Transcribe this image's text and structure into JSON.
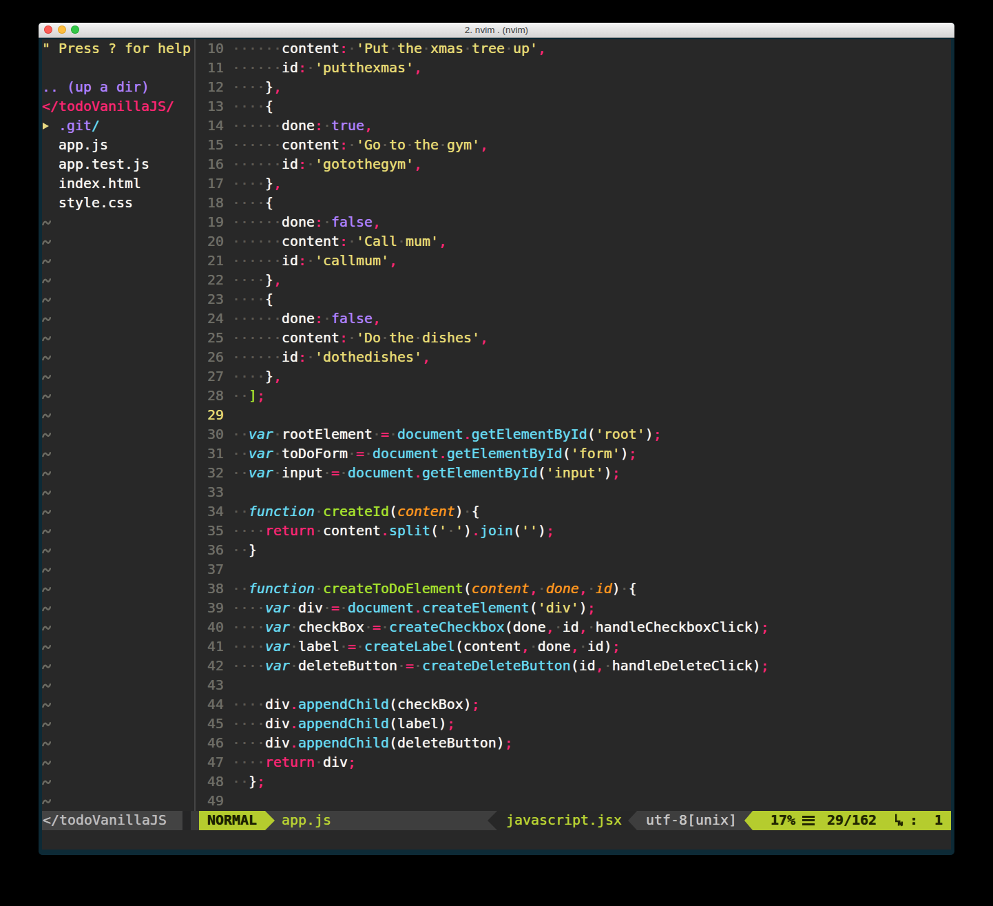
{
  "title_bar": {
    "title": "2. nvim . (nvim)",
    "buttons": [
      "close",
      "minimize",
      "zoom"
    ]
  },
  "colors": {
    "terminal_padding": "#0d2a36",
    "editor_background": "#282828",
    "foreground": "#f8f8f2",
    "pink": "#f92672",
    "yellow": "#e6db74",
    "cyan": "#66d9ef",
    "green": "#a6e22e",
    "orange": "#fd971f",
    "purple": "#ae81ff",
    "airline_green": "#b5cc2e"
  },
  "sidebar": {
    "rows": [
      [
        [
          "y",
          "\" Press ? for help"
        ]
      ],
      [],
      [
        [
          "u",
          ".. (up a dir)"
        ]
      ],
      [
        [
          "p",
          "</todoVanillaJS/"
        ]
      ],
      [
        [
          "arrow",
          ""
        ],
        [
          "w",
          " "
        ],
        [
          "u",
          ".git"
        ],
        [
          "c",
          "/"
        ]
      ],
      [
        [
          "w",
          "  app.js"
        ]
      ],
      [
        [
          "w",
          "  app.test.js"
        ]
      ],
      [
        [
          "w",
          "  index.html"
        ]
      ],
      [
        [
          "w",
          "  style.css"
        ]
      ]
    ],
    "tilde": "~",
    "tilde_count": 31
  },
  "editor": {
    "current_line": 29,
    "rows": [
      {
        "n": "10",
        "t": [
          [
            "w",
            "      content"
          ],
          [
            "p",
            ":"
          ],
          [
            "w",
            " "
          ],
          [
            "y",
            "'Put the xmas tree up'"
          ],
          [
            "p",
            ","
          ]
        ]
      },
      {
        "n": "11",
        "t": [
          [
            "w",
            "      id"
          ],
          [
            "p",
            ":"
          ],
          [
            "w",
            " "
          ],
          [
            "y",
            "'putthexmas'"
          ],
          [
            "p",
            ","
          ]
        ]
      },
      {
        "n": "12",
        "t": [
          [
            "w",
            "    }"
          ],
          [
            "p",
            ","
          ]
        ]
      },
      {
        "n": "13",
        "t": [
          [
            "w",
            "    {"
          ]
        ]
      },
      {
        "n": "14",
        "t": [
          [
            "w",
            "      done"
          ],
          [
            "p",
            ":"
          ],
          [
            "w",
            " "
          ],
          [
            "u",
            "true"
          ],
          [
            "p",
            ","
          ]
        ]
      },
      {
        "n": "15",
        "t": [
          [
            "w",
            "      content"
          ],
          [
            "p",
            ":"
          ],
          [
            "w",
            " "
          ],
          [
            "y",
            "'Go to the gym'"
          ],
          [
            "p",
            ","
          ]
        ]
      },
      {
        "n": "16",
        "t": [
          [
            "w",
            "      id"
          ],
          [
            "p",
            ":"
          ],
          [
            "w",
            " "
          ],
          [
            "y",
            "'gotothegym'"
          ],
          [
            "p",
            ","
          ]
        ]
      },
      {
        "n": "17",
        "t": [
          [
            "w",
            "    }"
          ],
          [
            "p",
            ","
          ]
        ]
      },
      {
        "n": "18",
        "t": [
          [
            "w",
            "    {"
          ]
        ]
      },
      {
        "n": "19",
        "t": [
          [
            "w",
            "      done"
          ],
          [
            "p",
            ":"
          ],
          [
            "w",
            " "
          ],
          [
            "u",
            "false"
          ],
          [
            "p",
            ","
          ]
        ]
      },
      {
        "n": "20",
        "t": [
          [
            "w",
            "      content"
          ],
          [
            "p",
            ":"
          ],
          [
            "w",
            " "
          ],
          [
            "y",
            "'Call mum'"
          ],
          [
            "p",
            ","
          ]
        ]
      },
      {
        "n": "21",
        "t": [
          [
            "w",
            "      id"
          ],
          [
            "p",
            ":"
          ],
          [
            "w",
            " "
          ],
          [
            "y",
            "'callmum'"
          ],
          [
            "p",
            ","
          ]
        ]
      },
      {
        "n": "22",
        "t": [
          [
            "w",
            "    }"
          ],
          [
            "p",
            ","
          ]
        ]
      },
      {
        "n": "23",
        "t": [
          [
            "w",
            "    {"
          ]
        ]
      },
      {
        "n": "24",
        "t": [
          [
            "w",
            "      done"
          ],
          [
            "p",
            ":"
          ],
          [
            "w",
            " "
          ],
          [
            "u",
            "false"
          ],
          [
            "p",
            ","
          ]
        ]
      },
      {
        "n": "25",
        "t": [
          [
            "w",
            "      content"
          ],
          [
            "p",
            ":"
          ],
          [
            "w",
            " "
          ],
          [
            "y",
            "'Do the dishes'"
          ],
          [
            "p",
            ","
          ]
        ]
      },
      {
        "n": "26",
        "t": [
          [
            "w",
            "      id"
          ],
          [
            "p",
            ":"
          ],
          [
            "w",
            " "
          ],
          [
            "y",
            "'dothedishes'"
          ],
          [
            "p",
            ","
          ]
        ]
      },
      {
        "n": "27",
        "t": [
          [
            "w",
            "    }"
          ],
          [
            "p",
            ","
          ]
        ]
      },
      {
        "n": "28",
        "t": [
          [
            "w",
            "  "
          ],
          [
            "g",
            "]"
          ],
          [
            "p",
            ";"
          ]
        ]
      },
      {
        "n": "29",
        "t": []
      },
      {
        "n": "30",
        "t": [
          [
            "w",
            "  "
          ],
          [
            "ci",
            "var"
          ],
          [
            "w",
            " rootElement "
          ],
          [
            "p",
            "="
          ],
          [
            "w",
            " "
          ],
          [
            "c",
            "document"
          ],
          [
            "p",
            "."
          ],
          [
            "c",
            "getElementById"
          ],
          [
            "w",
            "("
          ],
          [
            "y",
            "'root'"
          ],
          [
            "w",
            ")"
          ],
          [
            "p",
            ";"
          ]
        ]
      },
      {
        "n": "31",
        "t": [
          [
            "w",
            "  "
          ],
          [
            "ci",
            "var"
          ],
          [
            "w",
            " toDoForm "
          ],
          [
            "p",
            "="
          ],
          [
            "w",
            " "
          ],
          [
            "c",
            "document"
          ],
          [
            "p",
            "."
          ],
          [
            "c",
            "getElementById"
          ],
          [
            "w",
            "("
          ],
          [
            "y",
            "'form'"
          ],
          [
            "w",
            ")"
          ],
          [
            "p",
            ";"
          ]
        ]
      },
      {
        "n": "32",
        "t": [
          [
            "w",
            "  "
          ],
          [
            "ci",
            "var"
          ],
          [
            "w",
            " input "
          ],
          [
            "p",
            "="
          ],
          [
            "w",
            " "
          ],
          [
            "c",
            "document"
          ],
          [
            "p",
            "."
          ],
          [
            "c",
            "getElementById"
          ],
          [
            "w",
            "("
          ],
          [
            "y",
            "'input'"
          ],
          [
            "w",
            ")"
          ],
          [
            "p",
            ";"
          ]
        ]
      },
      {
        "n": "33",
        "t": []
      },
      {
        "n": "34",
        "t": [
          [
            "w",
            "  "
          ],
          [
            "ci",
            "function"
          ],
          [
            "w",
            " "
          ],
          [
            "g",
            "createId"
          ],
          [
            "w",
            "("
          ],
          [
            "o",
            "content"
          ],
          [
            "w",
            ") {"
          ]
        ]
      },
      {
        "n": "35",
        "t": [
          [
            "w",
            "    "
          ],
          [
            "p",
            "return"
          ],
          [
            "w",
            " content"
          ],
          [
            "p",
            "."
          ],
          [
            "c",
            "split"
          ],
          [
            "w",
            "("
          ],
          [
            "y",
            "' '"
          ],
          [
            "w",
            ")"
          ],
          [
            "p",
            "."
          ],
          [
            "c",
            "join"
          ],
          [
            "w",
            "("
          ],
          [
            "y",
            "''"
          ],
          [
            "w",
            ")"
          ],
          [
            "p",
            ";"
          ]
        ]
      },
      {
        "n": "36",
        "t": [
          [
            "w",
            "  }"
          ]
        ]
      },
      {
        "n": "37",
        "t": []
      },
      {
        "n": "38",
        "t": [
          [
            "w",
            "  "
          ],
          [
            "ci",
            "function"
          ],
          [
            "w",
            " "
          ],
          [
            "g",
            "createToDoElement"
          ],
          [
            "w",
            "("
          ],
          [
            "o",
            "content"
          ],
          [
            "p",
            ","
          ],
          [
            "w",
            " "
          ],
          [
            "o",
            "done"
          ],
          [
            "p",
            ","
          ],
          [
            "w",
            " "
          ],
          [
            "o",
            "id"
          ],
          [
            "w",
            ") {"
          ]
        ]
      },
      {
        "n": "39",
        "t": [
          [
            "w",
            "    "
          ],
          [
            "ci",
            "var"
          ],
          [
            "w",
            " div "
          ],
          [
            "p",
            "="
          ],
          [
            "w",
            " "
          ],
          [
            "c",
            "document"
          ],
          [
            "p",
            "."
          ],
          [
            "c",
            "createElement"
          ],
          [
            "w",
            "("
          ],
          [
            "y",
            "'div'"
          ],
          [
            "w",
            ")"
          ],
          [
            "p",
            ";"
          ]
        ]
      },
      {
        "n": "40",
        "t": [
          [
            "w",
            "    "
          ],
          [
            "ci",
            "var"
          ],
          [
            "w",
            " checkBox "
          ],
          [
            "p",
            "="
          ],
          [
            "w",
            " "
          ],
          [
            "c",
            "createCheckbox"
          ],
          [
            "w",
            "(done"
          ],
          [
            "p",
            ","
          ],
          [
            "w",
            " id"
          ],
          [
            "p",
            ","
          ],
          [
            "w",
            " handleCheckboxClick)"
          ],
          [
            "p",
            ";"
          ]
        ]
      },
      {
        "n": "41",
        "t": [
          [
            "w",
            "    "
          ],
          [
            "ci",
            "var"
          ],
          [
            "w",
            " label "
          ],
          [
            "p",
            "="
          ],
          [
            "w",
            " "
          ],
          [
            "c",
            "createLabel"
          ],
          [
            "w",
            "(content"
          ],
          [
            "p",
            ","
          ],
          [
            "w",
            " done"
          ],
          [
            "p",
            ","
          ],
          [
            "w",
            " id)"
          ],
          [
            "p",
            ";"
          ]
        ]
      },
      {
        "n": "42",
        "t": [
          [
            "w",
            "    "
          ],
          [
            "ci",
            "var"
          ],
          [
            "w",
            " deleteButton "
          ],
          [
            "p",
            "="
          ],
          [
            "w",
            " "
          ],
          [
            "c",
            "createDeleteButton"
          ],
          [
            "w",
            "(id"
          ],
          [
            "p",
            ","
          ],
          [
            "w",
            " handleDeleteClick)"
          ],
          [
            "p",
            ";"
          ]
        ]
      },
      {
        "n": "43",
        "t": []
      },
      {
        "n": "44",
        "t": [
          [
            "w",
            "    div"
          ],
          [
            "p",
            "."
          ],
          [
            "c",
            "appendChild"
          ],
          [
            "w",
            "(checkBox)"
          ],
          [
            "p",
            ";"
          ]
        ]
      },
      {
        "n": "45",
        "t": [
          [
            "w",
            "    div"
          ],
          [
            "p",
            "."
          ],
          [
            "c",
            "appendChild"
          ],
          [
            "w",
            "(label)"
          ],
          [
            "p",
            ";"
          ]
        ]
      },
      {
        "n": "46",
        "t": [
          [
            "w",
            "    div"
          ],
          [
            "p",
            "."
          ],
          [
            "c",
            "appendChild"
          ],
          [
            "w",
            "(deleteButton)"
          ],
          [
            "p",
            ";"
          ]
        ]
      },
      {
        "n": "47",
        "t": [
          [
            "w",
            "    "
          ],
          [
            "p",
            "return"
          ],
          [
            "w",
            " div"
          ],
          [
            "p",
            ";"
          ]
        ]
      },
      {
        "n": "48",
        "t": [
          [
            "w",
            "  }"
          ],
          [
            "p",
            ";"
          ]
        ]
      },
      {
        "n": "49",
        "t": []
      }
    ]
  },
  "statusline": {
    "tree_path": "</todoVanillaJS",
    "mode": "NORMAL",
    "filename": "app.js",
    "filetype": "javascript.jsx",
    "encoding": "utf-8[unix]",
    "scroll_percent": "17%",
    "line_position": "29/162",
    "colon": ":",
    "column": "1"
  }
}
